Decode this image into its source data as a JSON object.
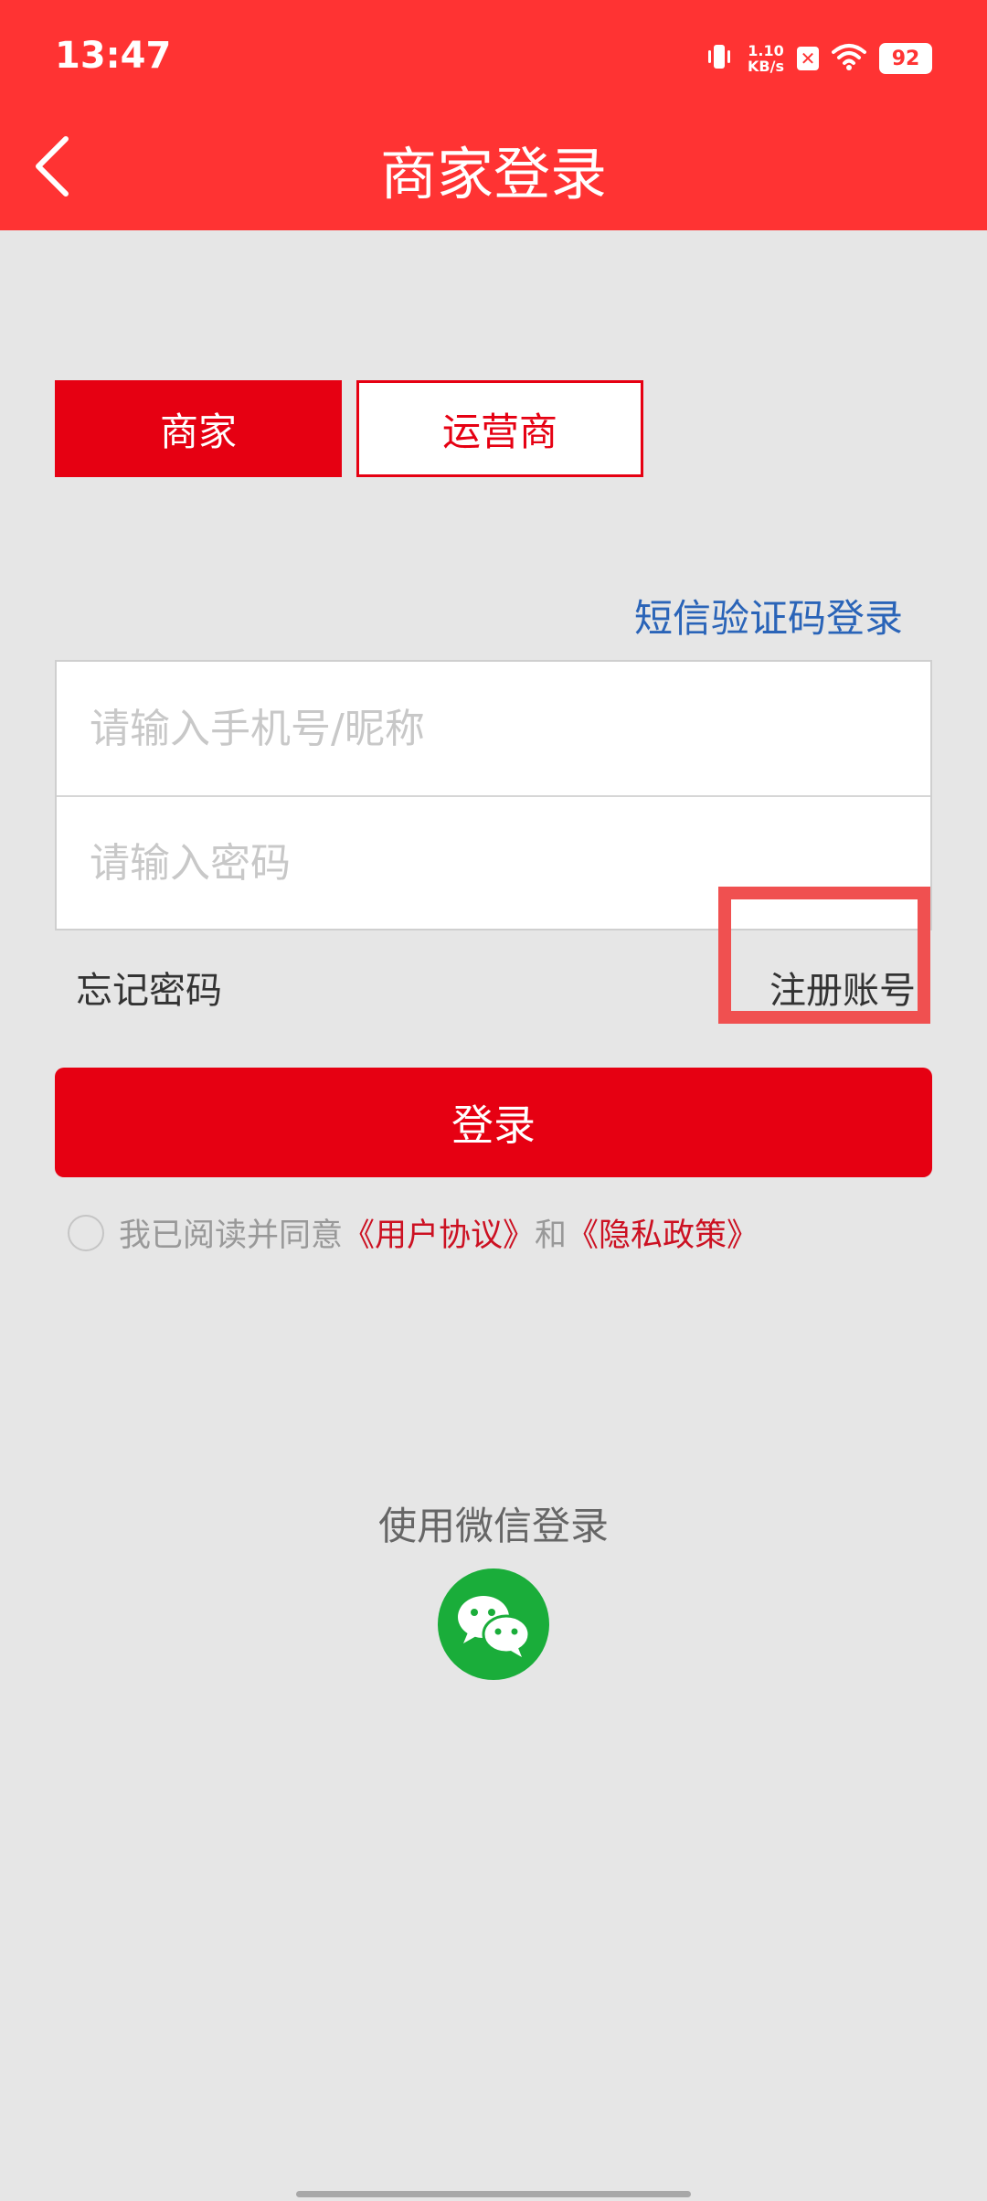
{
  "status_bar": {
    "time": "13:47",
    "net_speed_value": "1.10",
    "net_speed_unit": "KB/s",
    "battery": "92",
    "icons": [
      "vibrate-icon",
      "notification-x-icon",
      "wifi-icon",
      "battery-icon"
    ]
  },
  "header": {
    "title": "商家登录",
    "back_icon": "chevron-left-icon"
  },
  "tabs": [
    {
      "label": "商家",
      "selected": true
    },
    {
      "label": "运营商",
      "selected": false
    }
  ],
  "sms_login_label": "短信验证码登录",
  "form": {
    "phone_placeholder": "请输入手机号/昵称",
    "phone_value": "",
    "password_placeholder": "请输入密码",
    "password_value": ""
  },
  "forgot_password_label": "忘记密码",
  "register_label": "注册账号",
  "login_button_label": "登录",
  "agreement": {
    "prefix": "我已阅读并同意",
    "user_agreement": "《用户协议》",
    "and": "和",
    "privacy_policy": "《隐私政策》",
    "checked": false
  },
  "wechat_login_label": "使用微信登录",
  "colors": {
    "header_red": "#ff3333",
    "accent_red": "#e60012",
    "link_blue": "#2a64b8",
    "wechat_green": "#1aad3a",
    "background": "#e6e6e6"
  }
}
